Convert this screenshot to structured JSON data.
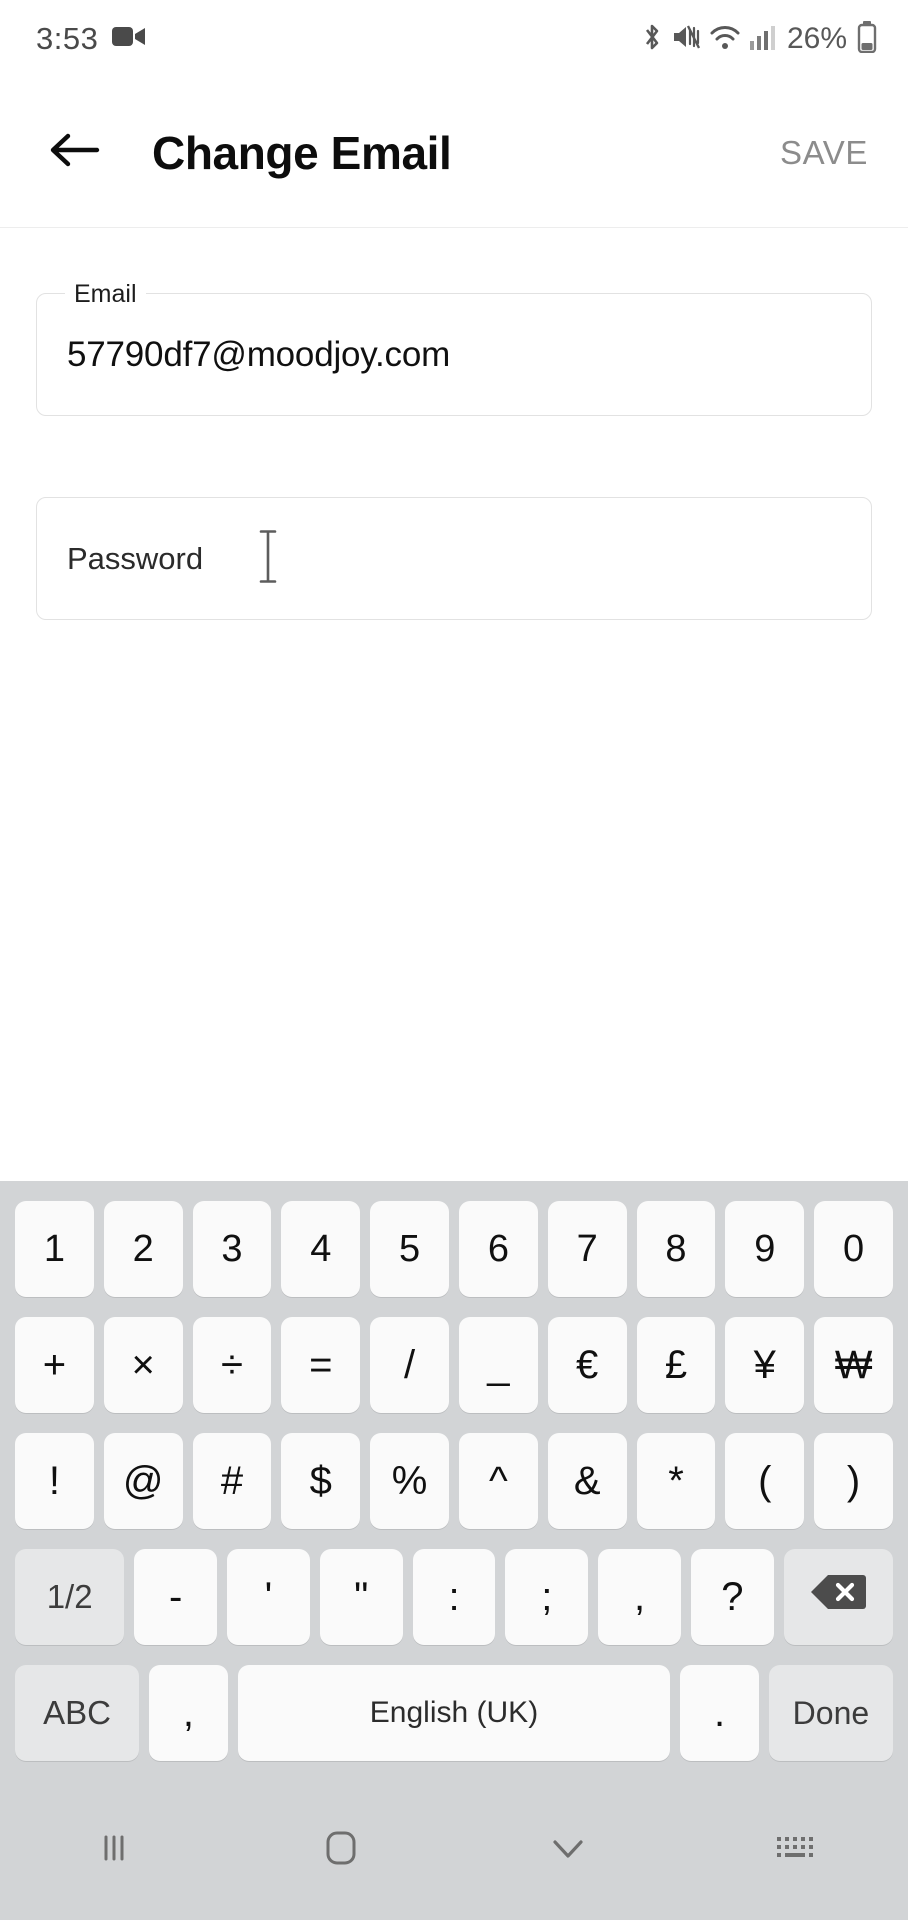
{
  "status_bar": {
    "time": "3:53",
    "battery_percent": "26%",
    "icons": [
      "video-camera-icon",
      "bluetooth-icon",
      "mute-icon",
      "wifi-icon",
      "cellular-signal-icon",
      "battery-icon"
    ]
  },
  "app_bar": {
    "back_icon": "arrow-left-icon",
    "title": "Change Email",
    "save_label": "SAVE"
  },
  "form": {
    "email_field": {
      "label": "Email",
      "value": "57790df7@moodjoy.com"
    },
    "password_field": {
      "placeholder": "Password",
      "value": ""
    }
  },
  "keyboard": {
    "row1": [
      "1",
      "2",
      "3",
      "4",
      "5",
      "6",
      "7",
      "8",
      "9",
      "0"
    ],
    "row2": [
      "+",
      "×",
      "÷",
      "=",
      "/",
      "_",
      "€",
      "£",
      "¥",
      "₩"
    ],
    "row3": [
      "!",
      "@",
      "#",
      "$",
      "%",
      "^",
      "&",
      "*",
      "(",
      ")"
    ],
    "row4": {
      "page_toggle": "1/2",
      "keys": [
        "-",
        "'",
        "\"",
        ":",
        ";",
        ",",
        "?"
      ],
      "backspace_icon": "backspace-icon"
    },
    "row5": {
      "abc": "ABC",
      "comma": ",",
      "space": "English (UK)",
      "period": ".",
      "done": "Done"
    }
  },
  "nav_bar": {
    "recents_icon": "recents-icon",
    "home_icon": "home-icon",
    "dismiss_keyboard_icon": "chevron-down-icon",
    "keyboard_switch_icon": "keyboard-icon"
  },
  "colors": {
    "keyboard_background": "#d2d4d6",
    "key_face": "#fafafa",
    "function_key": "#e6e7e8",
    "done_accent": "#4aa3f0",
    "save_label": "#8c8c8c"
  }
}
